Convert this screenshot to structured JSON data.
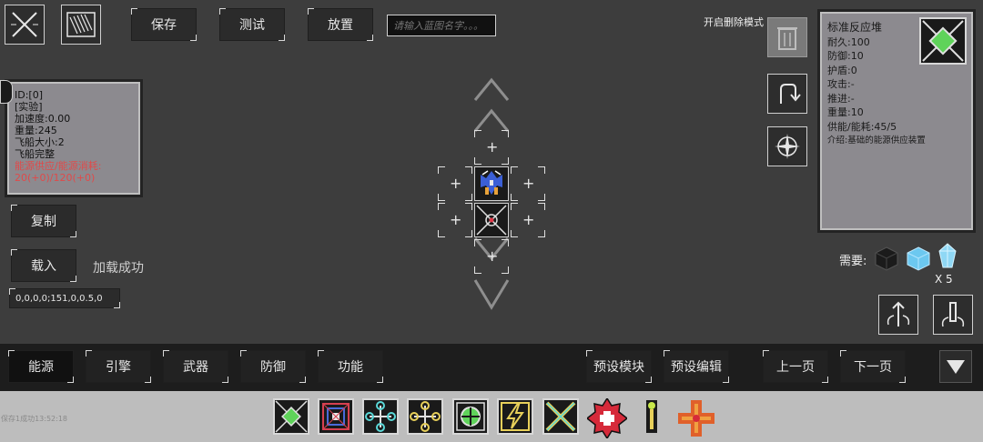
{
  "toolbar": {
    "save_label": "保存",
    "test_label": "测试",
    "place_label": "放置",
    "name_placeholder": "请输入蓝图名字。。。",
    "delete_mode_label": "开启删除模式"
  },
  "ship_stats": {
    "lines": [
      "ID:[0]",
      "[实验]",
      "加速度:0.00",
      "重量:245",
      "飞船大小:2",
      "飞船完整"
    ],
    "energy_label": "能源供应/能源消耗:",
    "energy_value": "20(+0)/120(+0)"
  },
  "left_actions": {
    "copy_label": "复制",
    "load_label": "载入",
    "load_status": "加载成功",
    "code_value": "0,0,0,0;151,0,0.5,0"
  },
  "module_info": {
    "name": "标准反应堆",
    "lines": [
      "耐久:100",
      "防御:10",
      "护盾:0",
      "攻击:-",
      "推进:-",
      "重量:10",
      "供能/能耗:45/5"
    ],
    "description": "介绍:基础的能源供应装置"
  },
  "requirements": {
    "label": "需要:",
    "count": "X 5"
  },
  "categories": [
    "能源",
    "引擎",
    "武器",
    "防御",
    "功能"
  ],
  "preset": {
    "module_label": "预设模块",
    "edit_label": "预设编辑"
  },
  "paging": {
    "prev_label": "上一页",
    "next_label": "下一页"
  },
  "footer": {
    "save_status": "保存1成功13:52:18"
  },
  "colors": {
    "accent_green": "#5fd35a",
    "energy_red": "#e04a4a",
    "panel_bg": "#8c8a8f"
  }
}
